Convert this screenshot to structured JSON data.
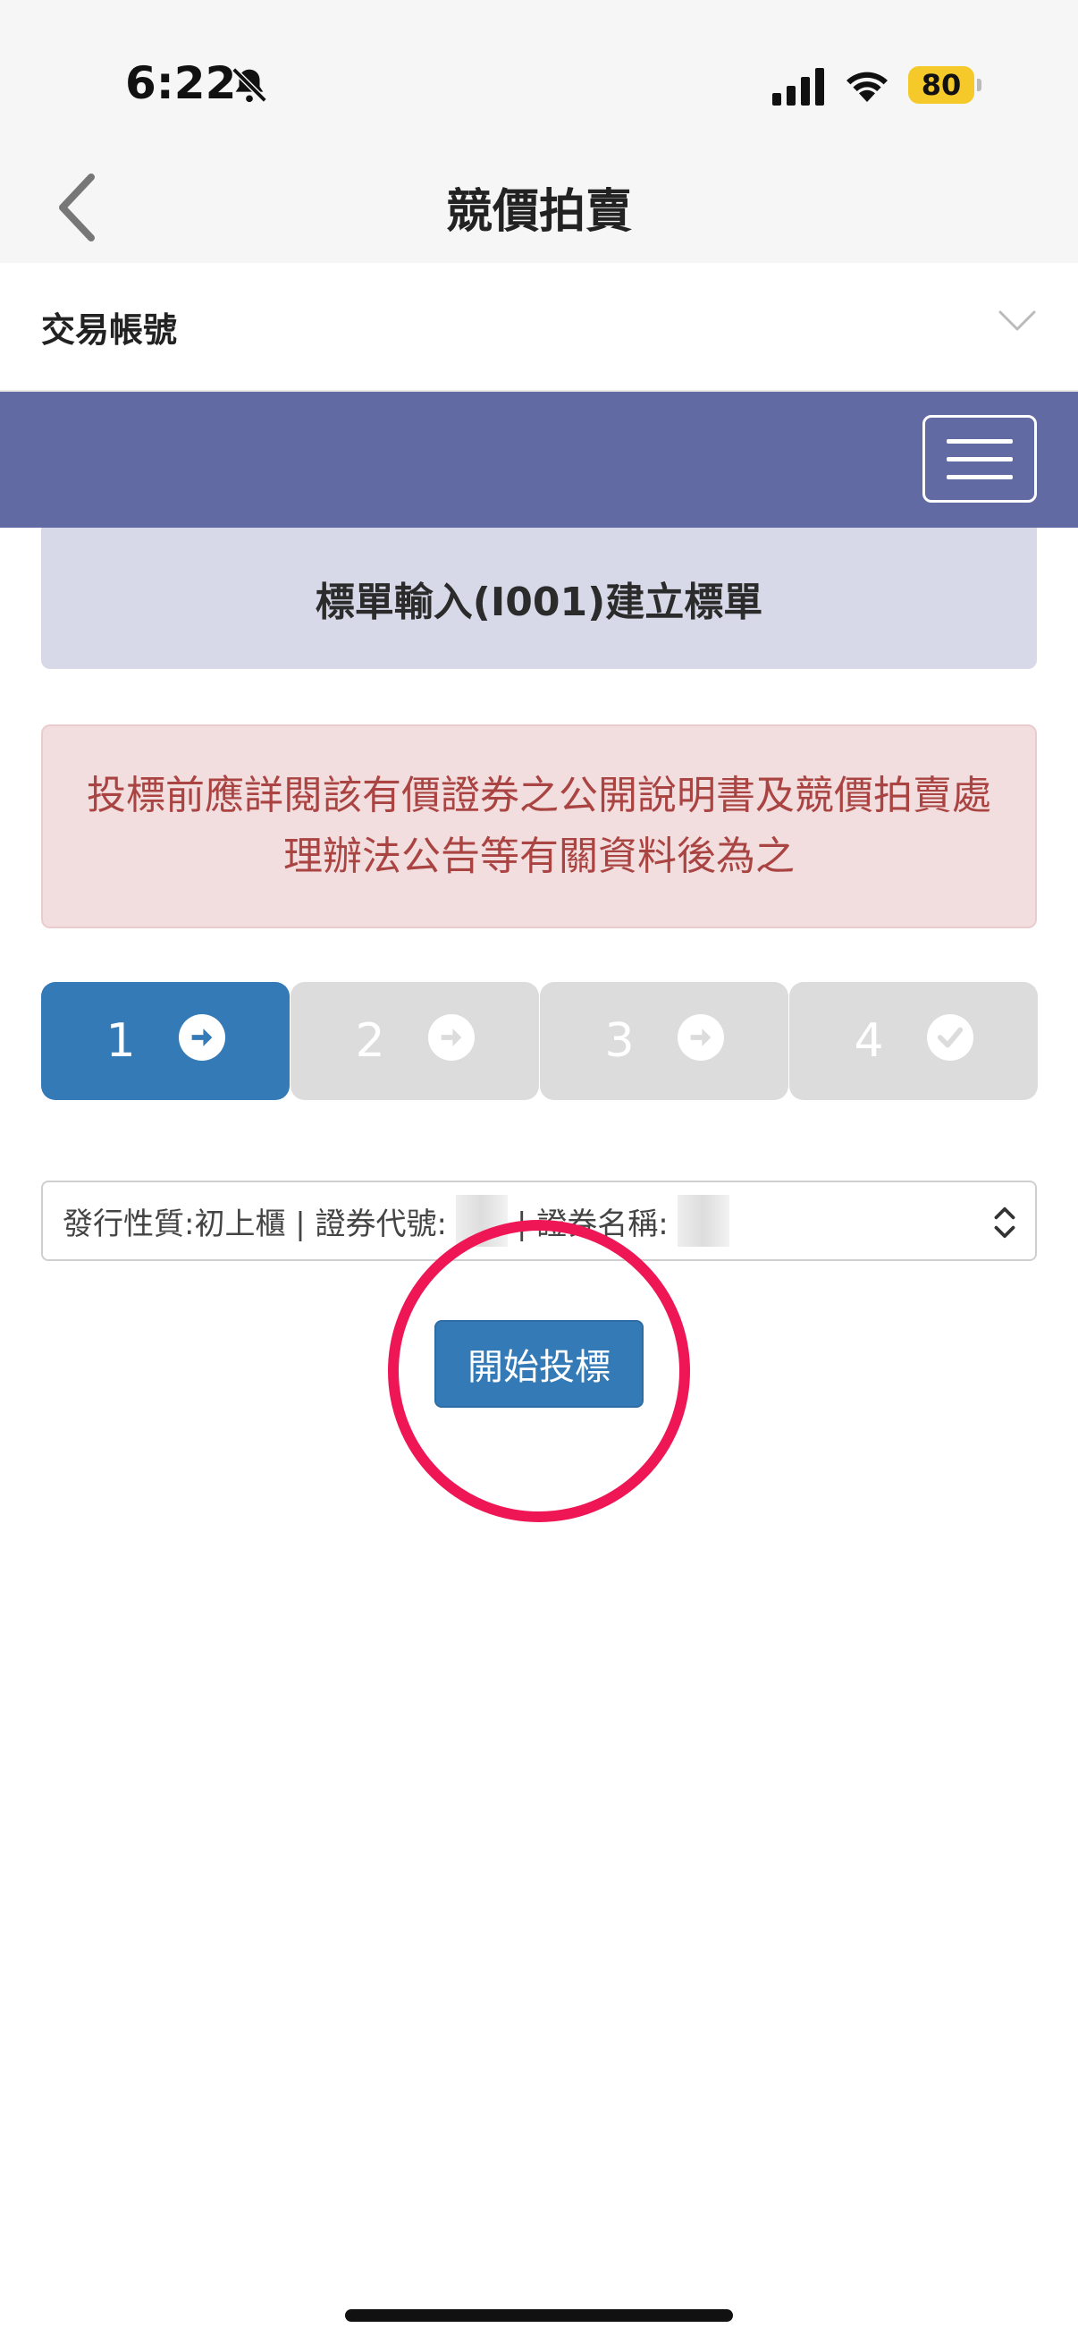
{
  "status_bar": {
    "time": "6:22",
    "battery": "80"
  },
  "nav": {
    "title": "競價拍賣"
  },
  "account": {
    "label": "交易帳號"
  },
  "section": {
    "title": "標單輸入(I001)建立標單"
  },
  "warning": {
    "text": "投標前應詳閱該有價證券之公開說明書及競價拍賣處理辦法公告等有關資料後為之"
  },
  "steps": [
    {
      "label": "1",
      "state": "active",
      "icon": "arrow-right-icon"
    },
    {
      "label": "2",
      "state": "inactive",
      "icon": "arrow-right-icon"
    },
    {
      "label": "3",
      "state": "inactive",
      "icon": "arrow-right-icon"
    },
    {
      "label": "4",
      "state": "inactive",
      "icon": "check-icon"
    }
  ],
  "select": {
    "part1": "發行性質:初上櫃 | 證券代號:",
    "part2": "| 證券名稱:"
  },
  "start_button": {
    "label": "開始投標"
  },
  "colors": {
    "primary": "#337ab7",
    "nav_bar": "#626aa3",
    "warning_text": "#a94442",
    "highlight_circle": "#ee1654"
  }
}
